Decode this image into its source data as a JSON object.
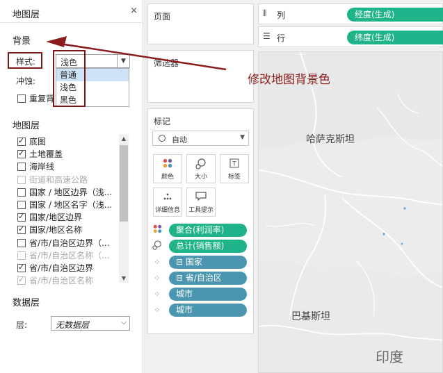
{
  "map_layers_panel": {
    "title": "地图层",
    "close_glyph": "×",
    "background": {
      "title": "背景",
      "style_label": "样式:",
      "style_value": "浅色",
      "style_options": [
        "普通",
        "浅色",
        "黑色"
      ],
      "selected_option_index": 0,
      "washout_label": "冲蚀:",
      "repeat_label": "重复背"
    },
    "layers": {
      "title": "地图层",
      "items": [
        {
          "label": "底图",
          "checked": true,
          "disabled": false
        },
        {
          "label": "土地覆盖",
          "checked": true,
          "disabled": false
        },
        {
          "label": "海岸线",
          "checked": false,
          "disabled": false
        },
        {
          "label": "街道和高速公路",
          "checked": false,
          "disabled": true
        },
        {
          "label": "国家 / 地区边界（浅...",
          "checked": false,
          "disabled": false
        },
        {
          "label": "国家 / 地区名字（浅...",
          "checked": false,
          "disabled": false
        },
        {
          "label": "国家/地区边界",
          "checked": true,
          "disabled": false
        },
        {
          "label": "国家/地区名称",
          "checked": true,
          "disabled": false
        },
        {
          "label": "省/市/自治区边界（...",
          "checked": false,
          "disabled": false
        },
        {
          "label": "省/市/自治区名称（...",
          "checked": false,
          "disabled": true
        },
        {
          "label": "省/市/自治区边界",
          "checked": true,
          "disabled": false
        },
        {
          "label": "省/市/自治区名称",
          "checked": true,
          "disabled": true
        }
      ]
    },
    "data_layer": {
      "title": "数据层",
      "layer_label": "层:",
      "layer_value": "无数据层"
    }
  },
  "pages_card": {
    "title": "页面"
  },
  "filters_card": {
    "title": "筛选器"
  },
  "marks_card": {
    "title": "标记",
    "mark_type": "自动",
    "buttons": [
      {
        "label": "颜色",
        "icon": "color-dots-icon"
      },
      {
        "label": "大小",
        "icon": "size-icon"
      },
      {
        "label": "标签",
        "icon": "label-T-icon"
      },
      {
        "label": "详细信息",
        "icon": "detail-dots-icon"
      },
      {
        "label": "工具提示",
        "icon": "tooltip-icon"
      }
    ],
    "fields": [
      {
        "label": "聚合(利润率)",
        "color": "green",
        "icon": "color-dots-icon"
      },
      {
        "label": "总计(销售额)",
        "color": "green",
        "icon": "size-icon"
      },
      {
        "label": "⊟ 国家",
        "color": "blue",
        "icon": "detail-dots-icon"
      },
      {
        "label": "⊟ 省/自治区",
        "color": "blue",
        "icon": "detail-dots-icon"
      },
      {
        "label": "城市",
        "color": "blue",
        "icon": "detail-dots-icon"
      },
      {
        "label": "城市",
        "color": "blue",
        "icon": "detail-dots-icon"
      }
    ]
  },
  "columns_shelf": {
    "label": "列",
    "pill": "经度(生成)"
  },
  "rows_shelf": {
    "label": "行",
    "pill": "纬度(生成)"
  },
  "map": {
    "labels": [
      "哈萨克斯坦",
      "巴基斯坦",
      "印度"
    ]
  },
  "annotation_text": "修改地图背景色",
  "colors": {
    "green_pill": "#1fb38a",
    "blue_pill": "#4a96b0",
    "annotation": "#8b1c1c"
  }
}
